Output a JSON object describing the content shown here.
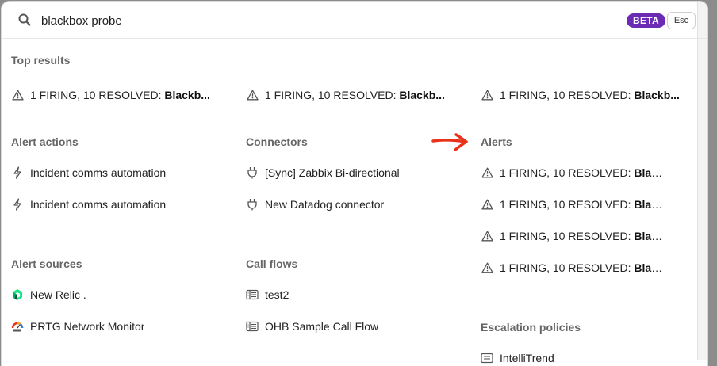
{
  "search": {
    "value": "blackbox probe",
    "badge": "BETA",
    "esc_label": "Esc"
  },
  "top_results": {
    "title": "Top results",
    "items": [
      {
        "prefix": "1 FIRING, 10 RESOLVED: ",
        "bold": "Blackb..."
      },
      {
        "prefix": "1 FIRING, 10 RESOLVED: ",
        "bold": "Blackb..."
      },
      {
        "prefix": "1 FIRING, 10 RESOLVED: ",
        "bold": "Blackb..."
      }
    ]
  },
  "alert_actions": {
    "title": "Alert actions",
    "items": [
      {
        "label": "Incident comms automation"
      },
      {
        "label": "Incident comms automation"
      }
    ]
  },
  "connectors": {
    "title": "Connectors",
    "items": [
      {
        "label": "[Sync] Zabbix Bi-directional"
      },
      {
        "label": "New Datadog connector"
      }
    ]
  },
  "alerts": {
    "title": "Alerts",
    "items": [
      {
        "prefix": "1 FIRING, 10 RESOLVED: ",
        "bold": "Blac..."
      },
      {
        "prefix": "1 FIRING, 10 RESOLVED: ",
        "bold": "Blac..."
      },
      {
        "prefix": "1 FIRING, 10 RESOLVED: ",
        "bold": "Blac..."
      },
      {
        "prefix": "1 FIRING, 10 RESOLVED: ",
        "bold": "Blac..."
      }
    ]
  },
  "alert_sources": {
    "title": "Alert sources",
    "items": [
      {
        "label": "New Relic ."
      },
      {
        "label": "PRTG Network Monitor"
      }
    ]
  },
  "call_flows": {
    "title": "Call flows",
    "items": [
      {
        "label": "test2"
      },
      {
        "label": "OHB Sample Call Flow"
      }
    ]
  },
  "escalation_policies": {
    "title": "Escalation policies",
    "items": [
      {
        "label": "IntelliTrend"
      }
    ]
  },
  "colors": {
    "accent": "#6b2bb5",
    "annotation_arrow": "#e8321a"
  }
}
